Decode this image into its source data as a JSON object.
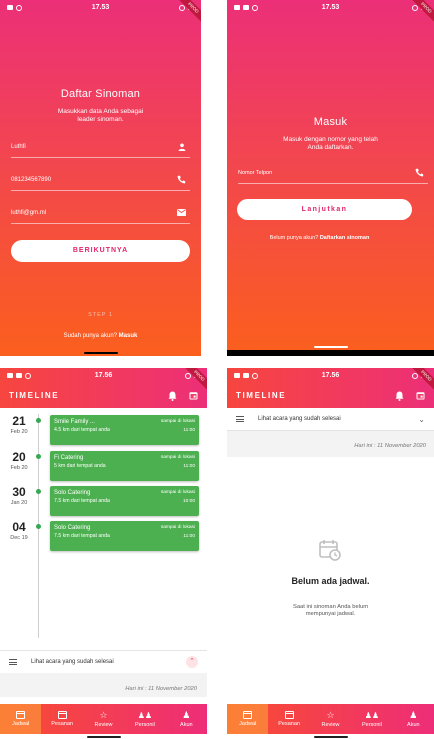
{
  "colors": {
    "accent": "#ec2f78",
    "orange": "#fb5f1d",
    "green": "#4cb050"
  },
  "badge": "PROD",
  "screen1": {
    "time": "17.53",
    "title": "Daftar Sinoman",
    "subtitle_line1": "Masukkan data Anda sebagai",
    "subtitle_line2": "leader sinoman.",
    "name_value": "Luthfi",
    "phone_value": "081234567890",
    "email_value": "luthfi@gm.ml",
    "next_button": "BERIKUTNYA",
    "step_label": "STEP 1",
    "footer_text": "Sudah punya akun? ",
    "footer_link": "Masuk"
  },
  "screen2": {
    "time": "17.53",
    "title": "Masuk",
    "subtitle_line1": "Masuk dengan nomor yang telah",
    "subtitle_line2": "Anda daftarkan.",
    "phone_placeholder": "Nomor Telpon",
    "continue_button": "Lanjutkan",
    "footer_text": "Belum punya akun? ",
    "footer_link": "Daftarkan sinoman"
  },
  "screen3": {
    "time": "17.56",
    "appbar_title": "TIMELINE",
    "rows": [
      {
        "day": "21",
        "month": "Feb 20",
        "name": "Smile Family ...",
        "distance": "4.5 km dari tempat anda",
        "status": "sampai di lokasi",
        "time": "11:00"
      },
      {
        "day": "20",
        "month": "Feb 20",
        "name": "Fi Catering",
        "distance": "5 km dari tempat anda",
        "status": "sampai di lokasi",
        "time": "11:00"
      },
      {
        "day": "30",
        "month": "Jan 20",
        "name": "Solo Catering",
        "distance": "7.5 km dari tempat anda",
        "status": "sampai di lokasi",
        "time": "10:00"
      },
      {
        "day": "04",
        "month": "Dec 19",
        "name": "Solo Catering",
        "distance": "7.5 km dari tempat anda",
        "status": "sampai di lokasi",
        "time": "11:00"
      }
    ],
    "finished_label": "Lihat acara yang sudah selesai",
    "today_label": "Hari ini : 11 November 2020"
  },
  "screen4": {
    "time": "17.56",
    "appbar_title": "TIMELINE",
    "finished_label": "Lihat acara yang sudah selesai",
    "today_label": "Hari ini : 11 November 2020",
    "empty_title": "Belum ada jadwal.",
    "empty_line1": "Saat ini sinoman Anda belum",
    "empty_line2": "mempunyai jadwal."
  },
  "nav_left": [
    "Jadwal",
    "Pesanan",
    "Review",
    "Personil",
    "Akun"
  ],
  "nav_right": [
    "Jadwal",
    "Pesanan",
    "Review",
    "Personil",
    "Akun"
  ]
}
